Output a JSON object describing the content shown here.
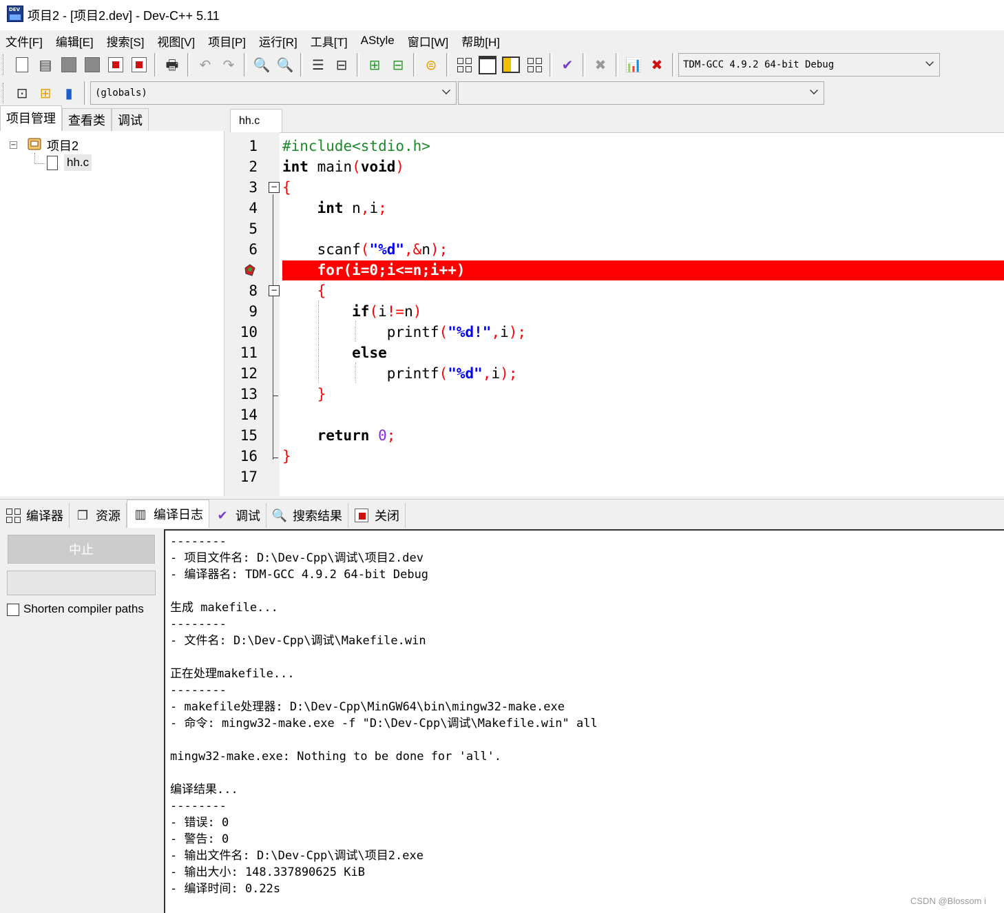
{
  "window": {
    "title": "项目2 - [项目2.dev] - Dev-C++ 5.11",
    "icon_label": "DEV"
  },
  "menu": [
    "文件[F]",
    "编辑[E]",
    "搜索[S]",
    "视图[V]",
    "项目[P]",
    "运行[R]",
    "工具[T]",
    "AStyle",
    "窗口[W]",
    "帮助[H]"
  ],
  "toolbar": {
    "compiler_select": "TDM-GCC 4.9.2 64-bit Debug",
    "scope_select": "(globals)",
    "symbol_select": ""
  },
  "left_panel": {
    "tabs": [
      "项目管理",
      "查看类",
      "调试"
    ],
    "tree": {
      "project": "项目2",
      "files": [
        "hh.c"
      ]
    }
  },
  "editor": {
    "tab": "hh.c",
    "breakpoint_line": 7,
    "line_numbers": [
      "1",
      "2",
      "3",
      "4",
      "5",
      "6",
      "",
      "8",
      "9",
      "10",
      "11",
      "12",
      "13",
      "14",
      "15",
      "16",
      "17"
    ]
  },
  "bottom_tabs": [
    "编译器",
    "资源",
    "编译日志",
    "调试",
    "搜索结果",
    "关闭"
  ],
  "compile_panel": {
    "stop_button": "中止",
    "shorten_label": "Shorten compiler paths"
  },
  "log_lines": [
    "--------",
    "- 项目文件名: D:\\Dev-Cpp\\调试\\项目2.dev",
    "- 编译器名: TDM-GCC 4.9.2 64-bit Debug",
    "",
    "生成 makefile...",
    "--------",
    "- 文件名: D:\\Dev-Cpp\\调试\\Makefile.win",
    "",
    "正在处理makefile...",
    "--------",
    "- makefile处理器: D:\\Dev-Cpp\\MinGW64\\bin\\mingw32-make.exe",
    "- 命令: mingw32-make.exe -f \"D:\\Dev-Cpp\\调试\\Makefile.win\" all",
    "",
    "mingw32-make.exe: Nothing to be done for 'all'.",
    "",
    "编译结果...",
    "--------",
    "- 错误: 0",
    "- 警告: 0",
    "- 输出文件名: D:\\Dev-Cpp\\调试\\项目2.exe",
    "- 输出大小: 148.337890625 KiB",
    "- 编译时间: 0.22s"
  ],
  "watermark": "CSDN @Blossom i",
  "colors": {
    "breakpoint": "#ff0000",
    "preprocessor": "#1a8a2a",
    "string": "#0000ff",
    "number": "#8a2be2"
  }
}
